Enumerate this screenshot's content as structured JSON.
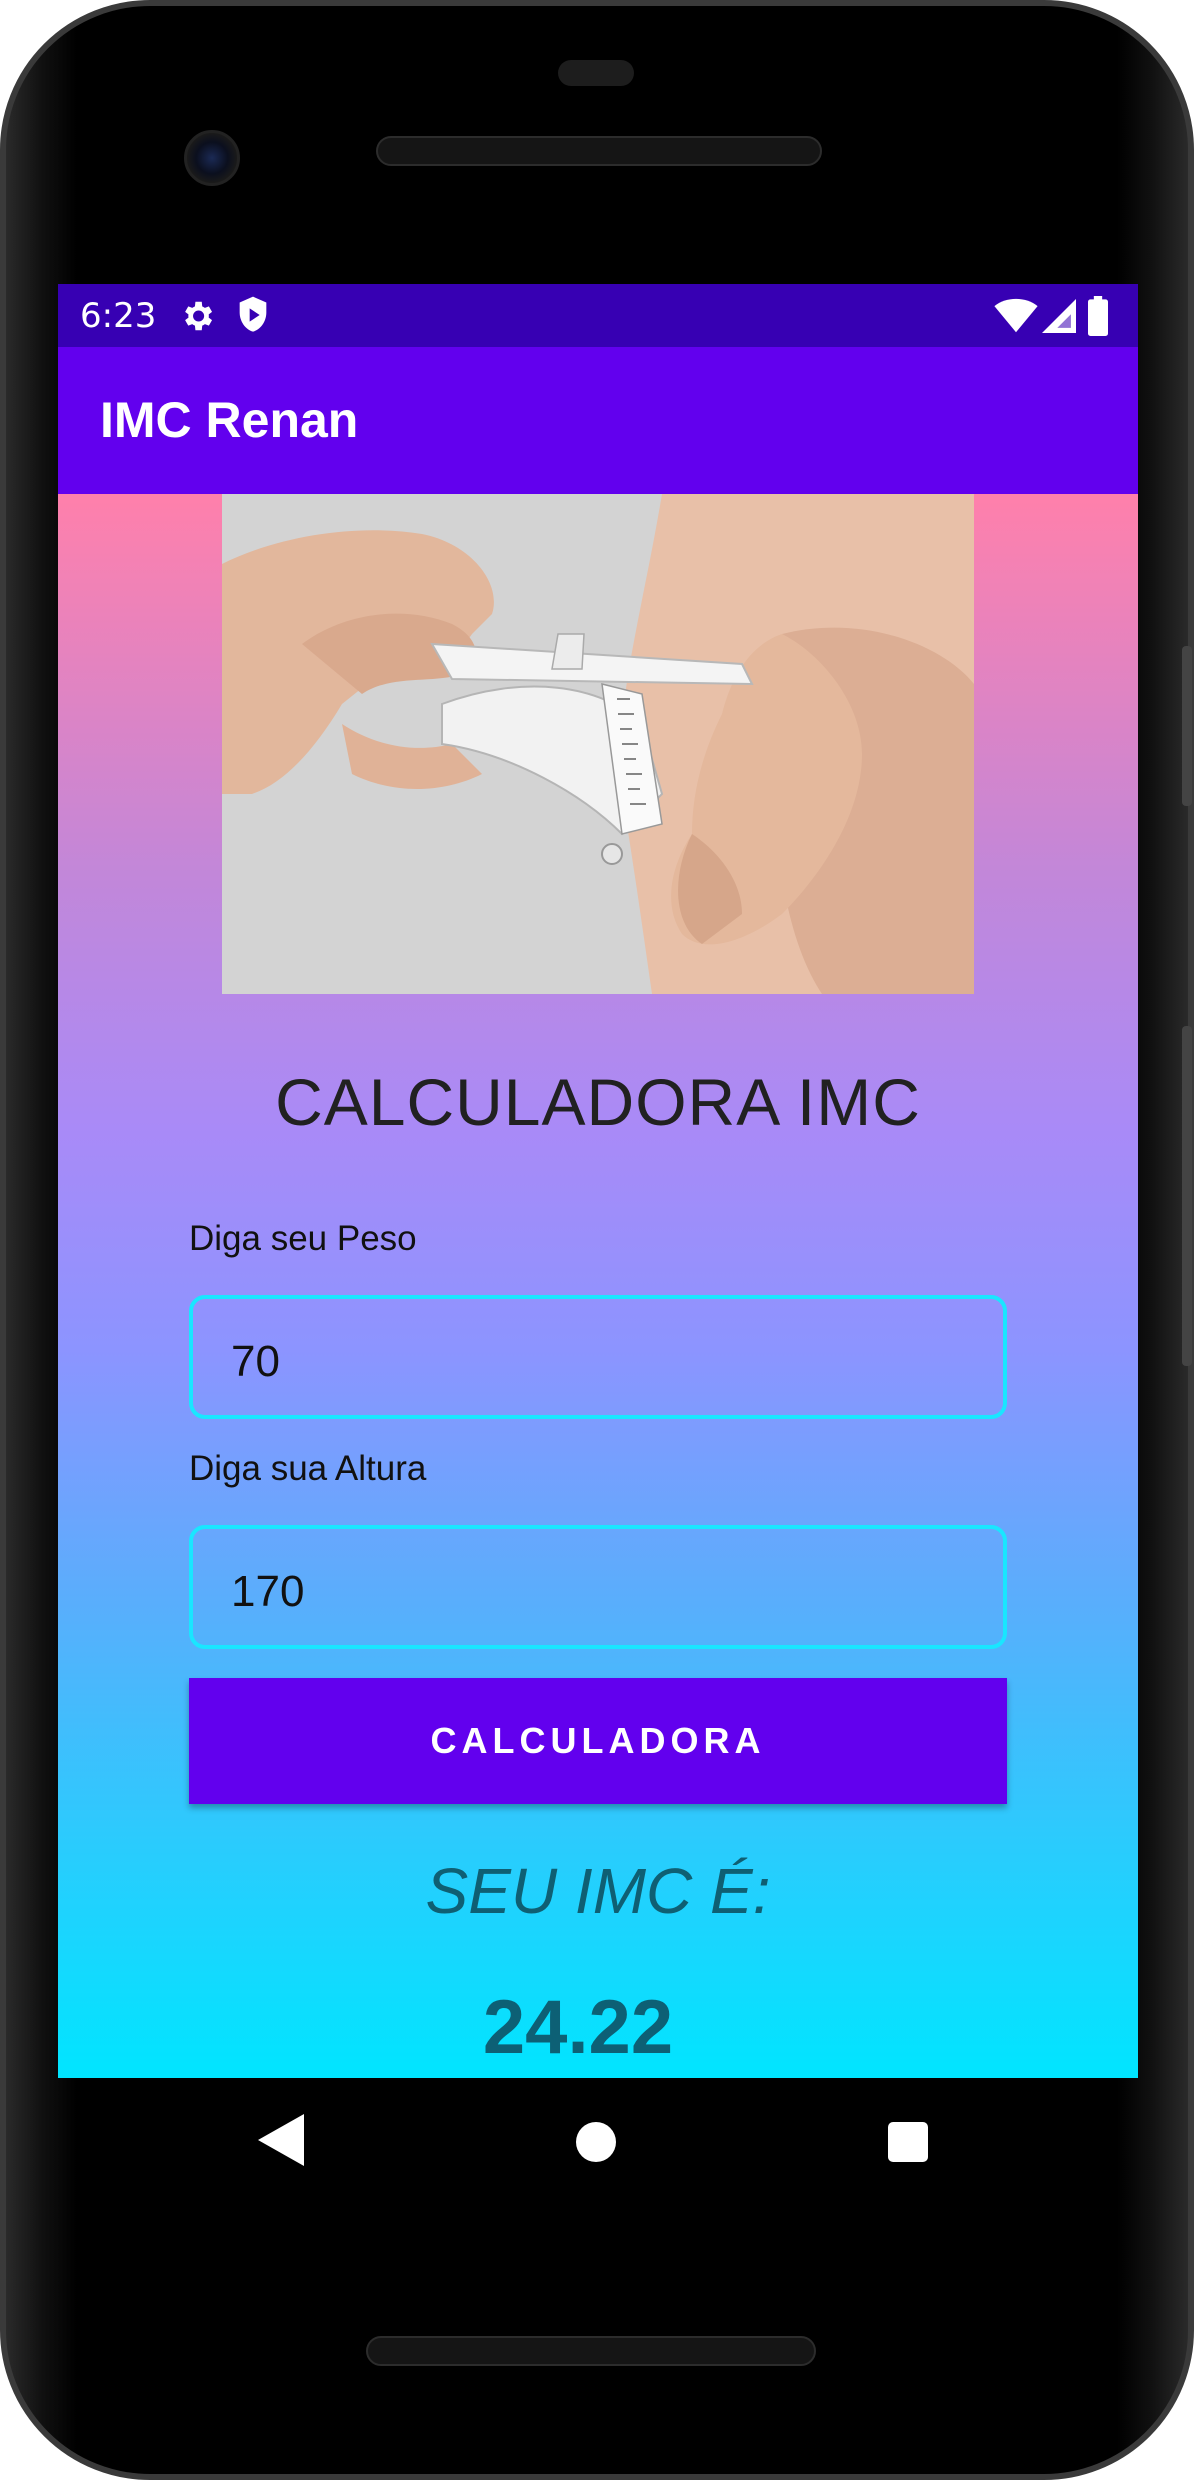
{
  "status_bar": {
    "time": "6:23",
    "icons": [
      "gear-icon",
      "shield-icon",
      "wifi-icon",
      "signal-icon",
      "battery-icon"
    ]
  },
  "app_bar": {
    "title": "IMC Renan",
    "color": "#6200ee"
  },
  "hero_image": {
    "description_icon": "skinfold-caliper-photo"
  },
  "main": {
    "heading": "CALCULADORA IMC",
    "weight": {
      "label": "Diga seu Peso",
      "value": "70"
    },
    "height": {
      "label": "Diga sua Altura",
      "value": "170"
    },
    "button_label": "CALCULADORA",
    "result_label": "SEU IMC É:",
    "result_value": "24.22"
  },
  "navigation": {
    "icons": [
      "back-icon",
      "home-icon",
      "recents-icon"
    ]
  },
  "colors": {
    "accent": "#6200ee",
    "status_bar": "#3700b3",
    "input_border": "#19e6ff",
    "result_text": "#0d6075"
  }
}
